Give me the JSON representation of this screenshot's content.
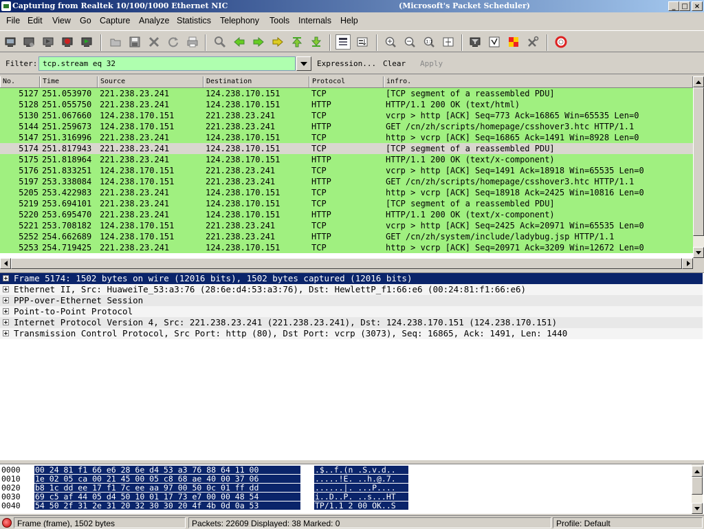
{
  "window": {
    "title": "Capturing from Realtek 10/100/1000 Ethernet NIC",
    "subtitle": "(Microsoft's Packet Scheduler)",
    "controls": {
      "minimize": "_",
      "maximize": "□",
      "close": "×"
    }
  },
  "menu": [
    "File",
    "Edit",
    "View",
    "Go",
    "Capture",
    "Analyze",
    "Statistics",
    "Telephony",
    "Tools",
    "Internals",
    "Help"
  ],
  "toolbar": {
    "icons": [
      "interfaces-icon",
      "options-icon",
      "start-icon",
      "stop-icon",
      "restart-icon",
      "open-icon",
      "save-icon",
      "close-icon",
      "reload-icon",
      "print-icon",
      "find-icon",
      "back-icon",
      "forward-icon",
      "goto-icon",
      "first-icon",
      "last-icon",
      "colorize-icon",
      "autoscroll-icon",
      "zoom-in-icon",
      "zoom-out-icon",
      "zoom-normal-icon",
      "resize-columns-icon",
      "capture-filters-icon",
      "display-filters-icon",
      "coloring-rules-icon",
      "preferences-icon",
      "help-icon"
    ]
  },
  "filter": {
    "label": "Filter:",
    "value": "tcp.stream eq 32",
    "expression": "Expression...",
    "clear": "Clear",
    "apply": "Apply"
  },
  "packet_list": {
    "headers": [
      "No.",
      "Time",
      "Source",
      "Destination",
      "Protocol",
      "infro."
    ],
    "rows": [
      {
        "no": "5127",
        "time": "251.053970",
        "src": "221.238.23.241",
        "dst": "124.238.170.151",
        "proto": "TCP",
        "info": "[TCP segment of a reassembled PDU]",
        "selected": false
      },
      {
        "no": "5128",
        "time": "251.055750",
        "src": "221.238.23.241",
        "dst": "124.238.170.151",
        "proto": "HTTP",
        "info": "HTTP/1.1 200 OK  (text/html)",
        "selected": false
      },
      {
        "no": "5130",
        "time": "251.067660",
        "src": "124.238.170.151",
        "dst": "221.238.23.241",
        "proto": "TCP",
        "info": "vcrp > http [ACK] Seq=773 Ack=16865 Win=65535 Len=0",
        "selected": false
      },
      {
        "no": "5144",
        "time": "251.259673",
        "src": "124.238.170.151",
        "dst": "221.238.23.241",
        "proto": "HTTP",
        "info": "GET /cn/zh/scripts/homepage/csshover3.htc HTTP/1.1",
        "selected": false
      },
      {
        "no": "5147",
        "time": "251.316996",
        "src": "221.238.23.241",
        "dst": "124.238.170.151",
        "proto": "TCP",
        "info": "http > vcrp [ACK] Seq=16865 Ack=1491 Win=8928 Len=0",
        "selected": false
      },
      {
        "no": "5174",
        "time": "251.817943",
        "src": "221.238.23.241",
        "dst": "124.238.170.151",
        "proto": "TCP",
        "info": "[TCP segment of a reassembled PDU]",
        "selected": true
      },
      {
        "no": "5175",
        "time": "251.818964",
        "src": "221.238.23.241",
        "dst": "124.238.170.151",
        "proto": "HTTP",
        "info": "HTTP/1.1 200 OK  (text/x-component)",
        "selected": false
      },
      {
        "no": "5176",
        "time": "251.833251",
        "src": "124.238.170.151",
        "dst": "221.238.23.241",
        "proto": "TCP",
        "info": "vcrp > http [ACK] Seq=1491 Ack=18918 Win=65535 Len=0",
        "selected": false
      },
      {
        "no": "5197",
        "time": "253.338084",
        "src": "124.238.170.151",
        "dst": "221.238.23.241",
        "proto": "HTTP",
        "info": "GET /cn/zh/scripts/homepage/csshover3.htc HTTP/1.1",
        "selected": false
      },
      {
        "no": "5205",
        "time": "253.422983",
        "src": "221.238.23.241",
        "dst": "124.238.170.151",
        "proto": "TCP",
        "info": "http > vcrp [ACK] Seq=18918 Ack=2425 Win=10816 Len=0",
        "selected": false
      },
      {
        "no": "5219",
        "time": "253.694101",
        "src": "221.238.23.241",
        "dst": "124.238.170.151",
        "proto": "TCP",
        "info": "[TCP segment of a reassembled PDU]",
        "selected": false
      },
      {
        "no": "5220",
        "time": "253.695470",
        "src": "221.238.23.241",
        "dst": "124.238.170.151",
        "proto": "HTTP",
        "info": "HTTP/1.1 200 OK  (text/x-component)",
        "selected": false
      },
      {
        "no": "5221",
        "time": "253.708182",
        "src": "124.238.170.151",
        "dst": "221.238.23.241",
        "proto": "TCP",
        "info": "vcrp > http [ACK] Seq=2425 Ack=20971 Win=65535 Len=0",
        "selected": false
      },
      {
        "no": "5252",
        "time": "254.662689",
        "src": "124.238.170.151",
        "dst": "221.238.23.241",
        "proto": "HTTP",
        "info": "GET /cn/zh/system/include/ladybug.jsp HTTP/1.1",
        "selected": false
      },
      {
        "no": "5253",
        "time": "254.719425",
        "src": "221.238.23.241",
        "dst": "124.238.170.151",
        "proto": "TCP",
        "info": "http > vcrp [ACK] Seq=20971 Ack=3209 Win=12672 Len=0",
        "selected": false
      }
    ],
    "row_color": "#a0f080",
    "selected_color": "#d9d7cf"
  },
  "details": [
    "Frame 5174: 1502 bytes on wire (12016 bits), 1502 bytes captured (12016 bits)",
    "Ethernet II, Src: HuaweiTe_53:a3:76 (28:6e:d4:53:a3:76), Dst: HewlettP_f1:66:e6 (00:24:81:f1:66:e6)",
    "PPP-over-Ethernet Session",
    "Point-to-Point Protocol",
    "Internet Protocol Version 4, Src: 221.238.23.241 (221.238.23.241), Dst: 124.238.170.151 (124.238.170.151)",
    "Transmission Control Protocol, Src Port: http (80), Dst Port: vcrp (3073), Seq: 16865, Ack: 1491, Len: 1440"
  ],
  "hex": [
    {
      "off": "0000",
      "bytes": "00 24 81 f1 66 e6 28 6e  d4 53 a3 76 88 64 11 00",
      "ascii": ".$..f.(n .S.v.d.."
    },
    {
      "off": "0010",
      "bytes": "1e 02 05 ca 00 21 45 00  05 c8 68 ae 40 00 37 06",
      "ascii": ".....!E. ..h.@.7."
    },
    {
      "off": "0020",
      "bytes": "b8 1c dd ee 17 f1 7c ee  aa 97 00 50 0c 01 ff dd",
      "ascii": "......|. ...P...."
    },
    {
      "off": "0030",
      "bytes": "69 c5 af 44 05 d4 50 10  01 17 73 e7 00 00 48 54",
      "ascii": "i..D..P. ..s...HT"
    },
    {
      "off": "0040",
      "bytes": "54 50 2f 31 2e 31 20 32  30 30 20 4f 4b 0d 0a 53",
      "ascii": "TP/1.1 2 00 OK..S"
    }
  ],
  "status": {
    "frame": "Frame (frame), 1502 bytes",
    "packets": "Packets: 22609 Displayed: 38 Marked: 0",
    "profile": "Profile: Default"
  }
}
